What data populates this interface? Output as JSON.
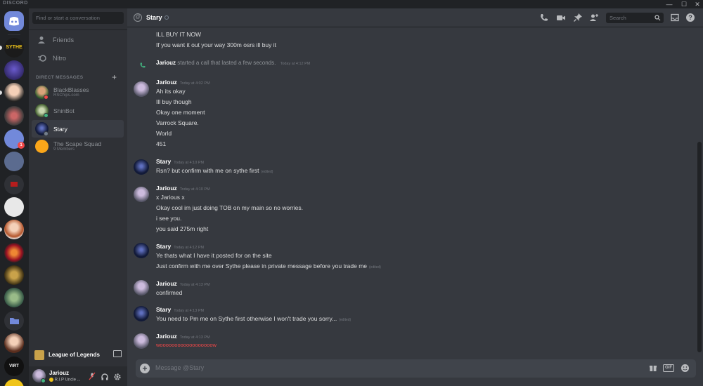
{
  "window": {
    "brand": "DISCORD",
    "minimize": "—",
    "maximize": "☐",
    "close": "✕"
  },
  "sidebar": {
    "search_placeholder": "Find or start a conversation",
    "nav": [
      {
        "label": "Friends",
        "icon": "friends-icon"
      },
      {
        "label": "Nitro",
        "icon": "nitro-icon"
      }
    ],
    "dm_header": "DIRECT MESSAGES",
    "dm_add": "+",
    "dms": [
      {
        "name": "BlackBlasses",
        "sub": "RSChips.com"
      },
      {
        "name": "ShinBot",
        "sub": ""
      },
      {
        "name": "Stary",
        "sub": "",
        "active": true
      },
      {
        "name": "The Scape Squad",
        "sub": "9 Members"
      }
    ],
    "activity": {
      "game": "League of Legends"
    },
    "user": {
      "name": "Jariouz",
      "status": "R.I.P Uncle ..."
    }
  },
  "guilds": {
    "badge": "1",
    "sythe_label": "SYTHE",
    "virt_label": "VIRT"
  },
  "header": {
    "channel_name": "Stary",
    "search_placeholder": "Search"
  },
  "messages": [
    {
      "lines": [
        "ILL BUY IT NOW",
        "If you want it out your way 300m osrs ill buy it"
      ]
    },
    {
      "system": true,
      "author": "Jariouz",
      "text": "started a call that lasted a few seconds.",
      "time": "Today at 4:12 PM"
    },
    {
      "author": "Jariouz",
      "time": "Today at 4:02 PM",
      "lines": [
        "Ah its okay",
        "Ill buy though",
        "Okay one moment",
        "Varrock Square.",
        "World",
        "451"
      ]
    },
    {
      "author": "Stary",
      "time": "Today at 4:10 PM",
      "lines": [
        "Rsn? but confirm with me on sythe first"
      ],
      "edited": "(edited)"
    },
    {
      "author": "Jariouz",
      "time": "Today at 4:10 PM",
      "lines": [
        "x Jarious x",
        "Okay cool im just doing TOB on my main so no worries.",
        "i see you.",
        "you said 275m right"
      ]
    },
    {
      "author": "Stary",
      "time": "Today at 4:12 PM",
      "lines": [
        "Ye thats what I have it posted for on the site",
        "Just confirm with me over Sythe please in private message before you trade me"
      ],
      "edited": "(edited)"
    },
    {
      "author": "Jariouz",
      "time": "Today at 4:13 PM",
      "lines": [
        "confirmed"
      ]
    },
    {
      "author": "Stary",
      "time": "Today at 4:13 PM",
      "lines": [
        "You need to Pm me on Sythe first otherwise I won't trade you sorry..."
      ],
      "edited": "(edited)"
    },
    {
      "author": "Jariouz",
      "time": "Today at 4:13 PM",
      "lines": [
        "woooooooooooooooooow"
      ]
    }
  ],
  "composer": {
    "placeholder": "Message @Stary",
    "gif": "GIF"
  },
  "colors": {
    "accent": "#7289da",
    "online": "#43b581",
    "dnd": "#f04747",
    "idle": "#faa61a"
  }
}
